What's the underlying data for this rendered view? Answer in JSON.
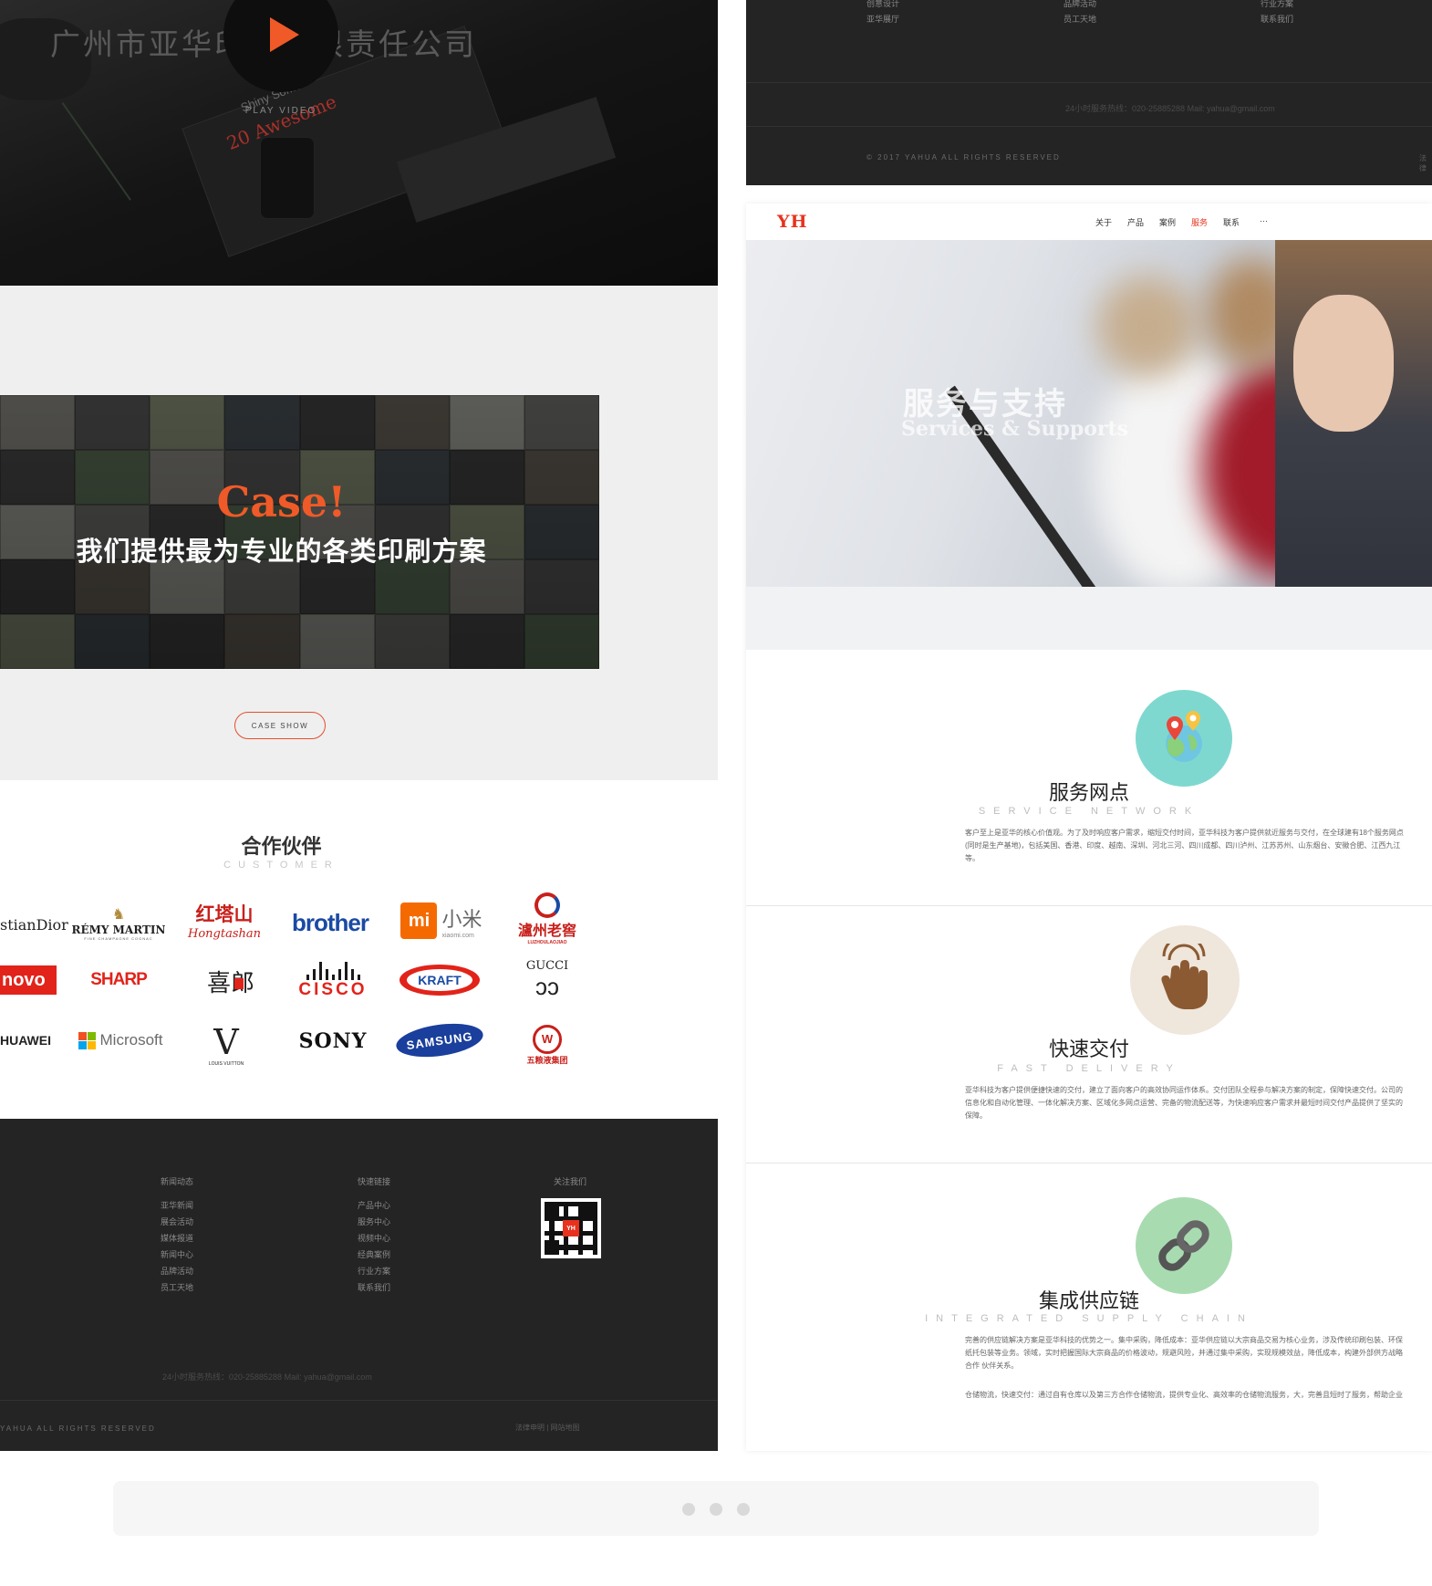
{
  "left": {
    "hero": {
      "title": "广州市亚华印刷有限责任公司",
      "play_label": "PLAY VIDEO",
      "book_text": "20 Awesome",
      "book_text2": "Shiny Some"
    },
    "case": {
      "word": "Case!",
      "subtitle": "我们提供最为专业的各类印刷方案",
      "button_label": "CASE SHOW"
    },
    "partners": {
      "title": "合作伙伴",
      "subtitle": "CUSTOMER",
      "logos": {
        "dior": "stianDior",
        "remy": "RÉMY MARTIN",
        "remy_sub": "FINE CHAMPAGNE COGNAC",
        "hongtashan": "红塔山",
        "hongtashan_sub": "Hongtashan",
        "brother": "brother",
        "mi_cn": "小米",
        "mi_sub": "xiaomi.com",
        "luzhou": "瀘州老窖",
        "luzhou_sub": "LUZHOULAOJIAO",
        "lenovo": "novo",
        "sharp": "SHARP",
        "xilang": "喜郎",
        "cisco": "CISCO",
        "kraft": "KRAFT",
        "gucci": "GUCCI",
        "huawei": "HUAWEI",
        "microsoft": "Microsoft",
        "lv_sub": "LOUIS VUITTON",
        "sony": "SONY",
        "samsung": "SAMSUNG",
        "wuliangye": "五粮液集团"
      }
    },
    "footer": {
      "col1": {
        "head": "新闻动态",
        "links": [
          "亚华新闻",
          "展会活动",
          "媒体报道",
          "新闻中心",
          "品牌活动",
          "员工天地"
        ]
      },
      "col2": {
        "head": "快速链接",
        "links": [
          "产品中心",
          "服务中心",
          "视频中心",
          "经典案例",
          "行业方案",
          "联系我们"
        ]
      },
      "col3": {
        "head": "关注我们"
      },
      "qr_mark": "YH",
      "hotline": "24小时服务热线：020-25885288    Mail: yahua@gmail.com",
      "copyright": "YAHUA ALL RIGHTS RESERVED",
      "legal_links": "法律申明  |  网站地图"
    }
  },
  "right": {
    "footer_top": {
      "col1": [
        "创意设计",
        "亚华展厅"
      ],
      "col2": [
        "品牌活动",
        "员工天地"
      ],
      "col3": [
        "行业方案",
        "联系我们"
      ],
      "hotline": "24小时服务热线：020-25885288    Mail: yahua@gmail.com",
      "copyright": "© 2017 YAHUA ALL RIGHTS RESERVED",
      "legal_link": "法律"
    },
    "nav": {
      "logo": "YH",
      "items": [
        "关于",
        "产品",
        "案例",
        "服务",
        "联系",
        "···"
      ],
      "active_color": "#e8321d"
    },
    "hero": {
      "title_cn": "服务与支持",
      "title_en": "Services & Supports"
    },
    "services": [
      {
        "title": "服务网点",
        "subtitle": "SERVICE NETWORK",
        "icon": "map-pin-icon",
        "desc": "客户至上是亚华的核心价值观。为了及时响应客户需求，缩短交付时间，亚华科技为客户提供就近服务与交付，在全球建有18个服务网点(同时是生产基地)，包括美国、香港、印度、越南、深圳、河北三河、四川成都、四川泸州、江苏苏州、山东烟台、安徽合肥、江西九江等。"
      },
      {
        "title": "快速交付",
        "subtitle": "FAST DELIVERY",
        "icon": "hand-touch-icon",
        "desc": "亚华科技为客户提供便捷快速的交付，建立了面向客户的高效协同运作体系。交付团队全程参与解决方案的制定，保障快速交付。公司的信息化和自动化管理、一体化解决方案、区域化多网点运营、完备的物流配送等，为快速响应客户需求并最短时间交付产品提供了坚实的保障。"
      },
      {
        "title": "集成供应链",
        "subtitle": "INTEGRATED SUPPLY CHAIN",
        "icon": "chain-link-icon",
        "desc": "完善的供应链解决方案是亚华科技的优势之一。集中采购，降低成本：亚华供应链以大宗商品交易为核心业务，涉及传统印刷包装、环保纸托包装等业务。领域，实时把握国际大宗商品的价格波动，规避风险，并通过集中采购，实现规模效益，降低成本，构建外部供方战略合作 伙伴关系。",
        "desc2": "仓储物流，快速交付：通过自有仓库以及第三方合作仓储物流，提供专业化、高效率的仓储物流服务，大，完善且短时了服务，帮助企业"
      }
    ]
  },
  "pager": {
    "dots": 3
  }
}
